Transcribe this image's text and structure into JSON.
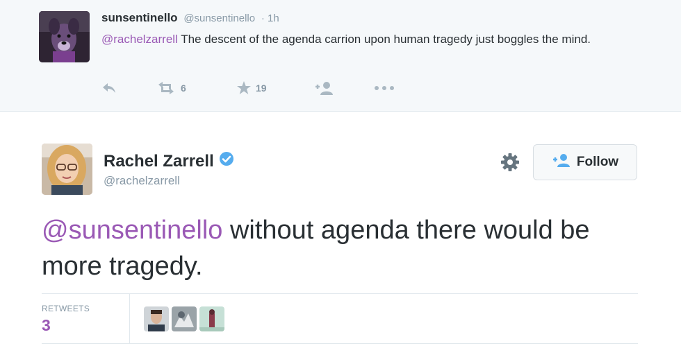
{
  "reply": {
    "name": "sunsentinello",
    "handle": "@sunsentinello",
    "time": "· 1h",
    "mention": "@rachelzarrell",
    "text": " The descent of the agenda carrion upon human tragedy just boggles the mind.",
    "retweet_count": "6",
    "favorite_count": "19"
  },
  "tweet": {
    "name": "Rachel Zarrell",
    "handle": "@rachelzarrell",
    "follow_label": "Follow",
    "mention": "@sunsentinello",
    "text": " without agenda there would be more tragedy.",
    "retweets_label": "RETWEETS",
    "retweets_count": "3"
  },
  "icons": {
    "reply": "reply-icon",
    "retweet": "retweet-icon",
    "favorite": "star-icon",
    "follow": "follow-user-icon",
    "more": "more-dots-icon",
    "settings": "gear-icon",
    "verified": "verified-badge-icon"
  },
  "colors": {
    "mention": "#9a59b5",
    "muted": "#8899a6",
    "verified": "#55acee",
    "reply_bg": "#f5f8fa"
  }
}
